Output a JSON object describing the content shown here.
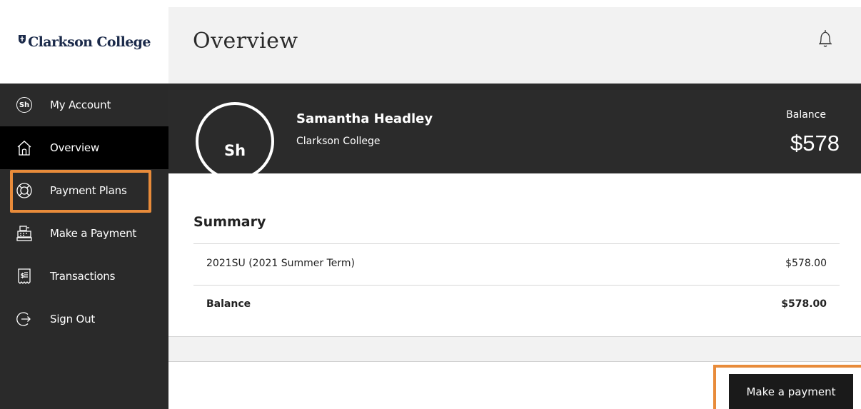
{
  "brand": {
    "name": "Clarkson College",
    "color": "#1b2a4a"
  },
  "header": {
    "title": "Overview"
  },
  "sidebar": {
    "items": [
      {
        "label": "My Account",
        "icon": "avatar-icon",
        "avatar_initials": "Sh"
      },
      {
        "label": "Overview",
        "icon": "home-icon",
        "active": true
      },
      {
        "label": "Payment Plans",
        "icon": "lifebuoy-icon"
      },
      {
        "label": "Make a Payment",
        "icon": "register-icon"
      },
      {
        "label": "Transactions",
        "icon": "receipt-icon"
      },
      {
        "label": "Sign Out",
        "icon": "sign-out-icon"
      }
    ]
  },
  "profile": {
    "initials": "Sh",
    "name": "Samantha Headley",
    "organization": "Clarkson College",
    "balance_label": "Balance",
    "balance_amount": "$578"
  },
  "summary": {
    "title": "Summary",
    "rows": [
      {
        "label": "2021SU (2021 Summer Term)",
        "value": "$578.00"
      },
      {
        "label": "Balance",
        "value": "$578.00",
        "bold": true
      }
    ]
  },
  "actions": {
    "make_payment_label": "Make a payment"
  },
  "colors": {
    "sidebar_bg": "#2a2a2a",
    "highlight": "#e88b3a",
    "header_bg": "#f2f2f2"
  }
}
